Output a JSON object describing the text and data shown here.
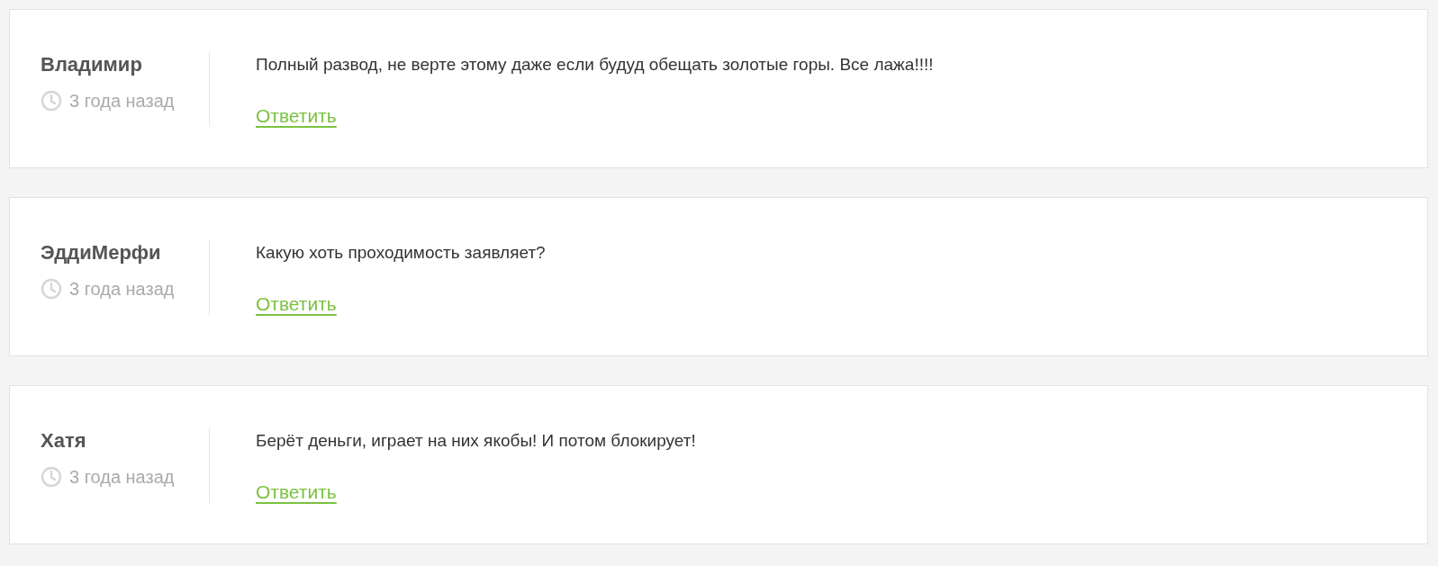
{
  "comments": [
    {
      "author": "Владимир",
      "time": "3 года назад",
      "text": "Полный развод, не верте этому даже если будуд обещать золотые горы. Все лажа!!!!",
      "reply": "Ответить"
    },
    {
      "author": "ЭддиМерфи",
      "time": "3 года назад",
      "text": "Какую хоть проходимость заявляет?",
      "reply": "Ответить"
    },
    {
      "author": "Хатя",
      "time": "3 года назад",
      "text": "Берёт деньги, играет на них якобы! И потом блокирует!",
      "reply": "Ответить"
    }
  ]
}
